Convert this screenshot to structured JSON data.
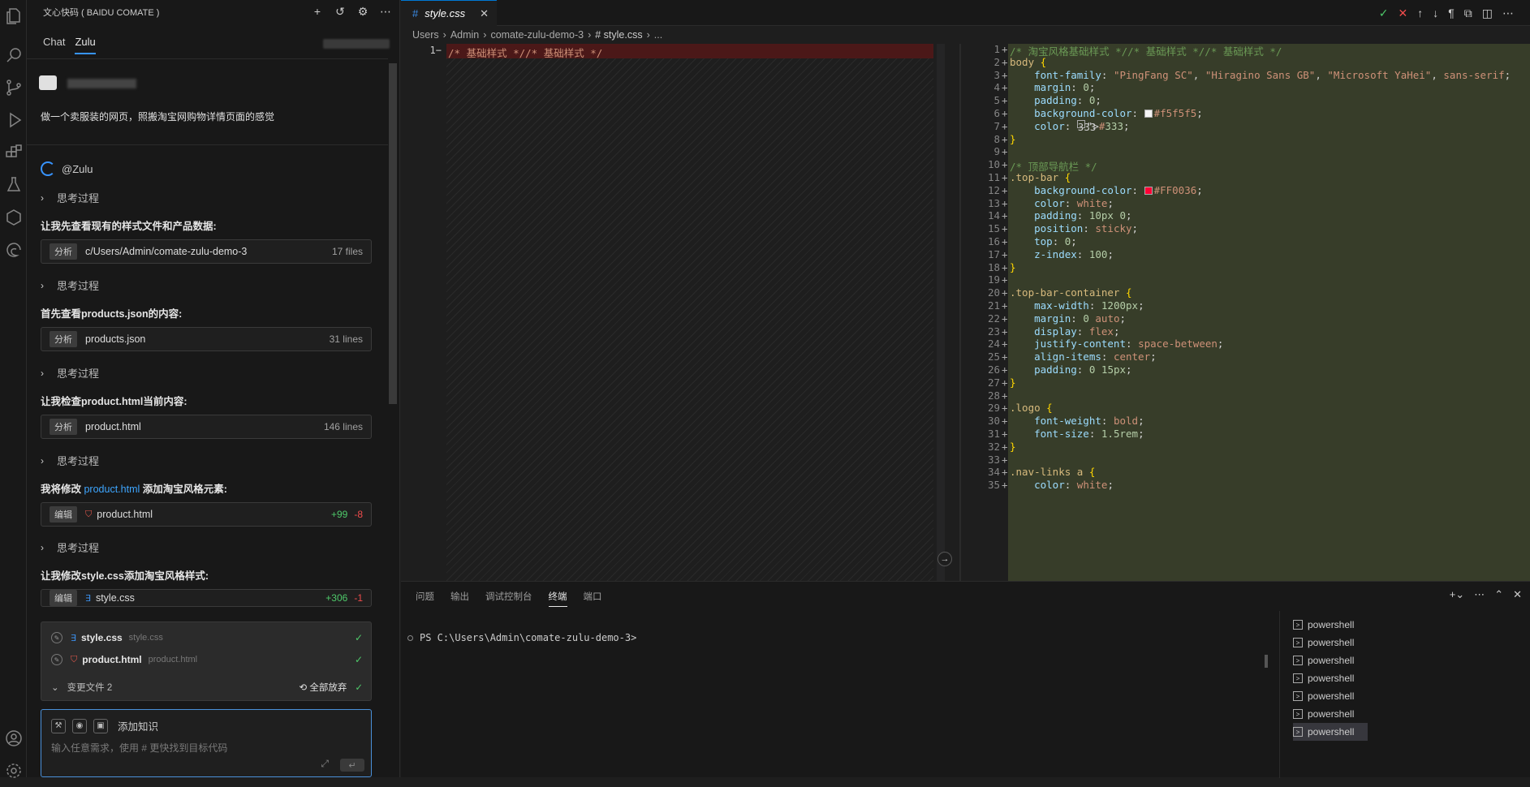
{
  "sidebar": {
    "title": "文心快码 ( BAIDU COMATE )",
    "tabs": [
      "Chat",
      "Zulu"
    ],
    "prompt": "做一个卖服装的网页，照搬淘宝网购物详情页面的感觉",
    "agent": "@Zulu",
    "think": "思考过程",
    "steps": [
      {
        "msg": "让我先查看现有的样式文件和产品数据:",
        "badge": "分析",
        "file": "c/Users/Admin/comate-zulu-demo-3",
        "meta": "17 files"
      },
      {
        "msg": "首先查看products.json的内容:",
        "badge": "分析",
        "file": "products.json",
        "meta": "31 lines"
      },
      {
        "msg": "让我检查product.html当前内容:",
        "badge": "分析",
        "file": "product.html",
        "meta": "146 lines"
      },
      {
        "msg_pre": "我将修改 ",
        "msg_link": "product.html",
        "msg_post": " 添加淘宝风格元素:",
        "badge": "编辑",
        "file": "product.html",
        "add": "+99",
        "del": "-8"
      },
      {
        "msg": "让我修改style.css添加淘宝风格样式:",
        "badge": "编辑",
        "file": "style.css",
        "add": "+306",
        "del": "-1"
      }
    ],
    "changes": {
      "files": [
        {
          "name": "style.css",
          "path": "style.css"
        },
        {
          "name": "product.html",
          "path": "product.html"
        }
      ],
      "footer": "变更文件 2",
      "discard": "全部放弃"
    },
    "input": {
      "knowledge": "添加知识",
      "placeholder": "输入任意需求，使用 # 更快找到目标代码"
    }
  },
  "editor": {
    "tab": "style.css",
    "breadcrumb": [
      "Users",
      "Admin",
      "comate-zulu-demo-3",
      "# style.css",
      "..."
    ],
    "left_line": "/* 基础样式 *//* 基础样式 */",
    "code": [
      "/* 淘宝风格基础样式 *//* 基础样式 *//* 基础样式 */",
      "body {",
      "    font-family: \"PingFang SC\", \"Hiragino Sans GB\", \"Microsoft YaHei\", sans-serif;",
      "    margin: 0;",
      "    padding: 0;",
      "    background-color: #f5f5f5;",
      "    color: #333;",
      "}",
      "",
      "/* 顶部导航栏 */",
      ".top-bar {",
      "    background-color: #FF0036;",
      "    color: white;",
      "    padding: 10px 0;",
      "    position: sticky;",
      "    top: 0;",
      "    z-index: 100;",
      "}",
      "",
      ".top-bar-container {",
      "    max-width: 1200px;",
      "    margin: 0 auto;",
      "    display: flex;",
      "    justify-content: space-between;",
      "    align-items: center;",
      "    padding: 0 15px;",
      "}",
      "",
      ".logo {",
      "    font-weight: bold;",
      "    font-size: 1.5rem;",
      "}",
      "",
      ".nav-links a {",
      "    color: white;"
    ]
  },
  "panel": {
    "tabs": [
      "问题",
      "输出",
      "调试控制台",
      "终端",
      "端口"
    ],
    "active_tab": "终端",
    "prompt": "PS C:\\Users\\Admin\\comate-zulu-demo-3>",
    "terminals": [
      "powershell",
      "powershell",
      "powershell",
      "powershell",
      "powershell",
      "powershell",
      "powershell"
    ]
  },
  "colors": {
    "accent": "#0078d4",
    "added": "#4ec96a",
    "removed": "#f14c4c",
    "link": "#3ea6ff"
  }
}
